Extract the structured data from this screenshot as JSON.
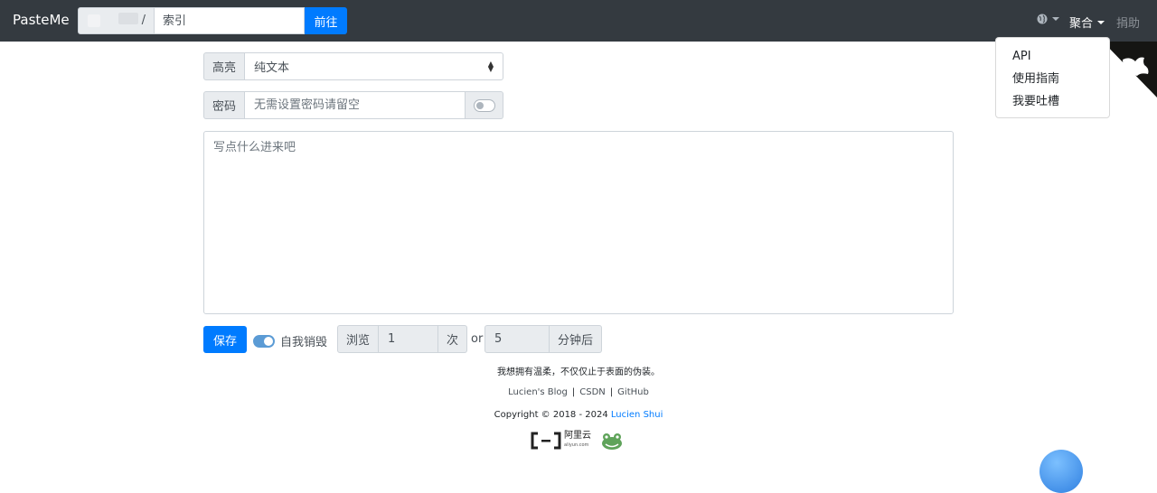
{
  "navbar": {
    "brand": "PasteMe",
    "search_prefix": "/",
    "search_placeholder": "索引",
    "go_label": "前往",
    "language_icon": "globe-icon",
    "aggregate_label": "聚合",
    "donate_label": "捐助"
  },
  "dropdown": {
    "items": [
      "API",
      "使用指南",
      "我要吐槽"
    ]
  },
  "form": {
    "highlight_label": "高亮",
    "highlight_value": "纯文本",
    "password_label": "密码",
    "password_placeholder": "无需设置密码请留空",
    "content_placeholder": "写点什么进来吧",
    "save_label": "保存",
    "self_destruct_label": "自我销毁",
    "views_label": "浏览",
    "views_value": "1",
    "views_unit": "次",
    "or_label": "or",
    "minutes_value": "5",
    "minutes_unit": "分钟后"
  },
  "footer": {
    "motto": "我想拥有温柔，不仅仅止于表面的伪装。",
    "links": [
      "Lucien's Blog",
      "CSDN",
      "GitHub"
    ],
    "copyright_prefix": "Copyright © 2018 - 2024 ",
    "copyright_author": "Lucien Shui",
    "aliyun_text": "阿里云",
    "aliyun_sub": "aliyun.com"
  },
  "colors": {
    "navbar": "#343a40",
    "primary": "#007bff"
  }
}
